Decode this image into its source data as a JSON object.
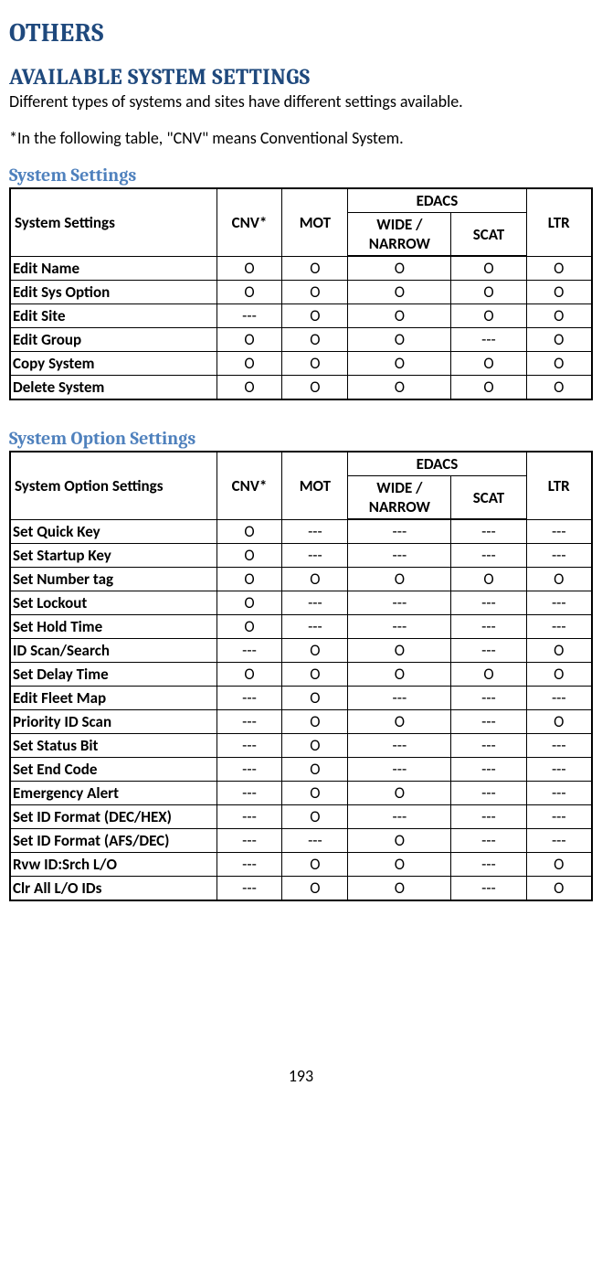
{
  "headings": {
    "h1": "OTHERS",
    "h2": "AVAILABLE SYSTEM SETTINGS",
    "h3a": "System Settings",
    "h3b": "System Option Settings"
  },
  "paragraphs": {
    "p1": "Different types of systems and sites have different settings available.",
    "p2": "*In the following table, \"CNV\" means Conventional System."
  },
  "table1": {
    "header": {
      "rowLabel": "System Settings",
      "cnv": "CNV*",
      "mot": "MOT",
      "edacs": "EDACS",
      "wide": "WIDE / NARROW",
      "scat": "SCAT",
      "ltr": "LTR"
    },
    "rows": [
      {
        "label": "Edit Name",
        "c": [
          "O",
          "O",
          "O",
          "O",
          "O"
        ]
      },
      {
        "label": "Edit Sys Option",
        "c": [
          "O",
          "O",
          "O",
          "O",
          "O"
        ]
      },
      {
        "label": "Edit Site",
        "c": [
          "---",
          "O",
          "O",
          "O",
          "O"
        ]
      },
      {
        "label": "Edit Group",
        "c": [
          "O",
          "O",
          "O",
          "---",
          "O"
        ]
      },
      {
        "label": "Copy System",
        "c": [
          "O",
          "O",
          "O",
          "O",
          "O"
        ]
      },
      {
        "label": "Delete System",
        "c": [
          "O",
          "O",
          "O",
          "O",
          "O"
        ]
      }
    ]
  },
  "table2": {
    "header": {
      "rowLabel": "System Option Settings",
      "cnv": "CNV*",
      "mot": "MOT",
      "edacs": "EDACS",
      "wide": "WIDE / NARROW",
      "scat": "SCAT",
      "ltr": "LTR"
    },
    "rows": [
      {
        "label": "Set Quick Key",
        "c": [
          "O",
          "---",
          "---",
          "---",
          "---"
        ]
      },
      {
        "label": "Set Startup Key",
        "c": [
          "O",
          "---",
          "---",
          "---",
          "---"
        ]
      },
      {
        "label": "Set Number tag",
        "c": [
          "O",
          "O",
          "O",
          "O",
          "O"
        ]
      },
      {
        "label": "Set Lockout",
        "c": [
          "O",
          "---",
          "---",
          "---",
          "---"
        ]
      },
      {
        "label": "Set Hold Time",
        "c": [
          "O",
          "---",
          "---",
          "---",
          "---"
        ]
      },
      {
        "label": "ID Scan/Search",
        "c": [
          "---",
          "O",
          "O",
          "---",
          "O"
        ]
      },
      {
        "label": "Set Delay Time",
        "c": [
          "O",
          "O",
          "O",
          "O",
          "O"
        ]
      },
      {
        "label": "Edit Fleet Map",
        "c": [
          "---",
          "O",
          "---",
          "---",
          "---"
        ]
      },
      {
        "label": "Priority ID Scan",
        "c": [
          "---",
          "O",
          "O",
          "---",
          "O"
        ]
      },
      {
        "label": "Set Status Bit",
        "c": [
          "---",
          "O",
          "---",
          "---",
          "---"
        ]
      },
      {
        "label": "Set End Code",
        "c": [
          "---",
          "O",
          "---",
          "---",
          "---"
        ]
      },
      {
        "label": "Emergency Alert",
        "c": [
          "---",
          "O",
          "O",
          "---",
          "---"
        ]
      },
      {
        "label": "Set ID Format (DEC/HEX)",
        "c": [
          "---",
          "O",
          "---",
          "---",
          "---"
        ]
      },
      {
        "label": "Set ID Format (AFS/DEC)",
        "c": [
          "---",
          "---",
          "O",
          "---",
          "---"
        ]
      },
      {
        "label": "Rvw ID:Srch L/O",
        "c": [
          "---",
          "O",
          "O",
          "---",
          "O"
        ]
      },
      {
        "label": "Clr All L/O IDs",
        "c": [
          "---",
          "O",
          "O",
          "---",
          "O"
        ]
      }
    ]
  },
  "pageNumber": "193",
  "chart_data": [
    {
      "type": "table",
      "title": "System Settings",
      "columns": [
        "System Settings",
        "CNV*",
        "MOT",
        "EDACS WIDE/NARROW",
        "EDACS SCAT",
        "LTR"
      ],
      "rows": [
        [
          "Edit Name",
          "O",
          "O",
          "O",
          "O",
          "O"
        ],
        [
          "Edit Sys Option",
          "O",
          "O",
          "O",
          "O",
          "O"
        ],
        [
          "Edit Site",
          "---",
          "O",
          "O",
          "O",
          "O"
        ],
        [
          "Edit Group",
          "O",
          "O",
          "O",
          "---",
          "O"
        ],
        [
          "Copy System",
          "O",
          "O",
          "O",
          "O",
          "O"
        ],
        [
          "Delete System",
          "O",
          "O",
          "O",
          "O",
          "O"
        ]
      ]
    },
    {
      "type": "table",
      "title": "System Option Settings",
      "columns": [
        "System Option Settings",
        "CNV*",
        "MOT",
        "EDACS WIDE/NARROW",
        "EDACS SCAT",
        "LTR"
      ],
      "rows": [
        [
          "Set Quick Key",
          "O",
          "---",
          "---",
          "---",
          "---"
        ],
        [
          "Set Startup Key",
          "O",
          "---",
          "---",
          "---",
          "---"
        ],
        [
          "Set Number tag",
          "O",
          "O",
          "O",
          "O",
          "O"
        ],
        [
          "Set Lockout",
          "O",
          "---",
          "---",
          "---",
          "---"
        ],
        [
          "Set Hold Time",
          "O",
          "---",
          "---",
          "---",
          "---"
        ],
        [
          "ID Scan/Search",
          "---",
          "O",
          "O",
          "---",
          "O"
        ],
        [
          "Set Delay Time",
          "O",
          "O",
          "O",
          "O",
          "O"
        ],
        [
          "Edit Fleet Map",
          "---",
          "O",
          "---",
          "---",
          "---"
        ],
        [
          "Priority ID Scan",
          "---",
          "O",
          "O",
          "---",
          "O"
        ],
        [
          "Set Status Bit",
          "---",
          "O",
          "---",
          "---",
          "---"
        ],
        [
          "Set End Code",
          "---",
          "O",
          "---",
          "---",
          "---"
        ],
        [
          "Emergency Alert",
          "---",
          "O",
          "O",
          "---",
          "---"
        ],
        [
          "Set ID Format (DEC/HEX)",
          "---",
          "O",
          "---",
          "---",
          "---"
        ],
        [
          "Set ID Format (AFS/DEC)",
          "---",
          "---",
          "O",
          "---",
          "---"
        ],
        [
          "Rvw ID:Srch L/O",
          "---",
          "O",
          "O",
          "---",
          "O"
        ],
        [
          "Clr All L/O IDs",
          "---",
          "O",
          "O",
          "---",
          "O"
        ]
      ]
    }
  ]
}
